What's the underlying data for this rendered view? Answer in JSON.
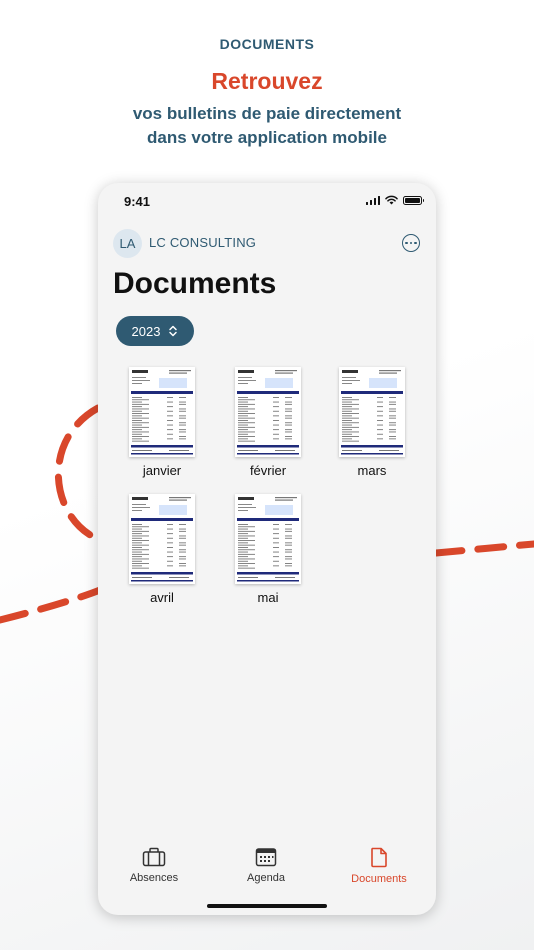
{
  "promo": {
    "kicker": "DOCUMENTS",
    "title": "Retrouvez",
    "subtitle_line1": "vos bulletins de paie directement",
    "subtitle_line2": "dans votre application mobile"
  },
  "status_bar": {
    "time": "9:41"
  },
  "header": {
    "avatar_initials": "LA",
    "company_name": "LC CONSULTING",
    "more_icon": "ellipsis-circle-icon"
  },
  "page": {
    "title": "Documents"
  },
  "year_selector": {
    "value": "2023",
    "icon": "chevron-up-down-icon"
  },
  "documents": [
    {
      "label": "janvier"
    },
    {
      "label": "février"
    },
    {
      "label": "mars"
    },
    {
      "label": "avril"
    },
    {
      "label": "mai"
    }
  ],
  "tabs": [
    {
      "label": "Absences",
      "icon": "briefcase-icon",
      "active": false
    },
    {
      "label": "Agenda",
      "icon": "calendar-icon",
      "active": false
    },
    {
      "label": "Documents",
      "icon": "document-icon",
      "active": true
    }
  ],
  "colors": {
    "brand_blue": "#2f5a72",
    "accent_red": "#d9472b",
    "screen_bg": "#f4f4f4"
  }
}
